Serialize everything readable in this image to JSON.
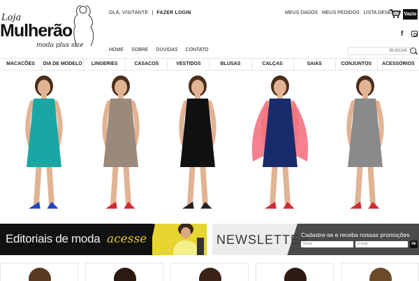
{
  "header": {
    "logo": {
      "line1": "Loja",
      "line2": "Mulherão",
      "tagline": "moda plus size"
    },
    "greeting": "OLÁ, VISITANTE",
    "separator": "|",
    "login": "FAZER LOGIN",
    "account_links": [
      "MEUS DADOS",
      "MEUS PEDIDOS",
      "LISTA DESEJOS"
    ],
    "cart_label": "Vazio",
    "social": {
      "facebook": "f"
    },
    "nav": [
      "HOME",
      "SOBRE",
      "DÚVIDAS",
      "CONTATO"
    ],
    "search": {
      "placeholder": "BUSCAR"
    }
  },
  "categories": [
    "MACACÕES",
    "DIA DE MODELO",
    "LINGERIES",
    "CASACOS",
    "VESTIDOS",
    "BLUSAS",
    "CALÇAS",
    "SAIAS",
    "CONJUNTOS",
    "ACESSÓRIOS"
  ],
  "hero_models": [
    {
      "dress_color": "#1aa7a3",
      "shoe_color": "#1f46c7"
    },
    {
      "dress_color": "#9b8a7c",
      "shoe_color": "#d02a37"
    },
    {
      "dress_color": "#111111",
      "shoe_color": "#222222"
    },
    {
      "dress_color": "#1a2b6b",
      "shoe_color": "#d02a37",
      "cardigan": "#f36b7b"
    },
    {
      "dress_color": "#8a8a8a",
      "shoe_color": "#d02a37"
    }
  ],
  "banners": {
    "editorial": {
      "text": "Editoriais de moda",
      "cta": "acesse"
    },
    "newsletter": {
      "title": "NEWSLETTER",
      "subtitle": "Cadastre-se e receba nossas promoções",
      "name_placeholder": "Nome",
      "email_placeholder": "E-mail",
      "submit": "Ok"
    }
  },
  "colors": {
    "accent_yellow": "#e4c826",
    "dark": "#111111"
  }
}
